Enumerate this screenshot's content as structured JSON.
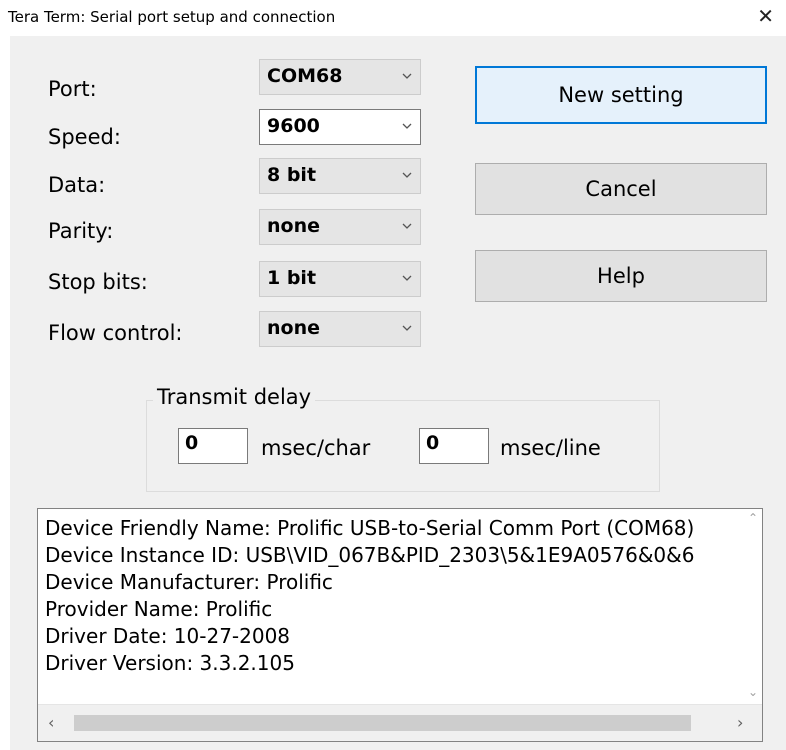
{
  "window": {
    "title": "Tera Term: Serial port setup and connection"
  },
  "fields": [
    {
      "label": "Port:",
      "value": "COM68"
    },
    {
      "label": "Speed:",
      "value": "9600"
    },
    {
      "label": "Data:",
      "value": "8 bit"
    },
    {
      "label": "Parity:",
      "value": "none"
    },
    {
      "label": "Stop bits:",
      "value": "1 bit"
    },
    {
      "label": "Flow control:",
      "value": "none"
    }
  ],
  "buttons": {
    "new_setting": "New setting",
    "cancel": "Cancel",
    "help": "Help"
  },
  "transmit_delay": {
    "title": "Transmit delay",
    "char_value": "0",
    "char_unit": "msec/char",
    "line_value": "0",
    "line_unit": "msec/line"
  },
  "device_info": [
    "Device Friendly Name: Prolific USB-to-Serial Comm Port (COM68)",
    "Device Instance ID: USB\\VID_067B&PID_2303\\5&1E9A0576&0&6",
    "Device Manufacturer: Prolific",
    "Provider Name: Prolific",
    "Driver Date: 10-27-2008",
    "Driver Version: 3.3.2.105"
  ],
  "icons": {
    "close": "close-icon",
    "dropdown": "chevron-down-icon"
  }
}
